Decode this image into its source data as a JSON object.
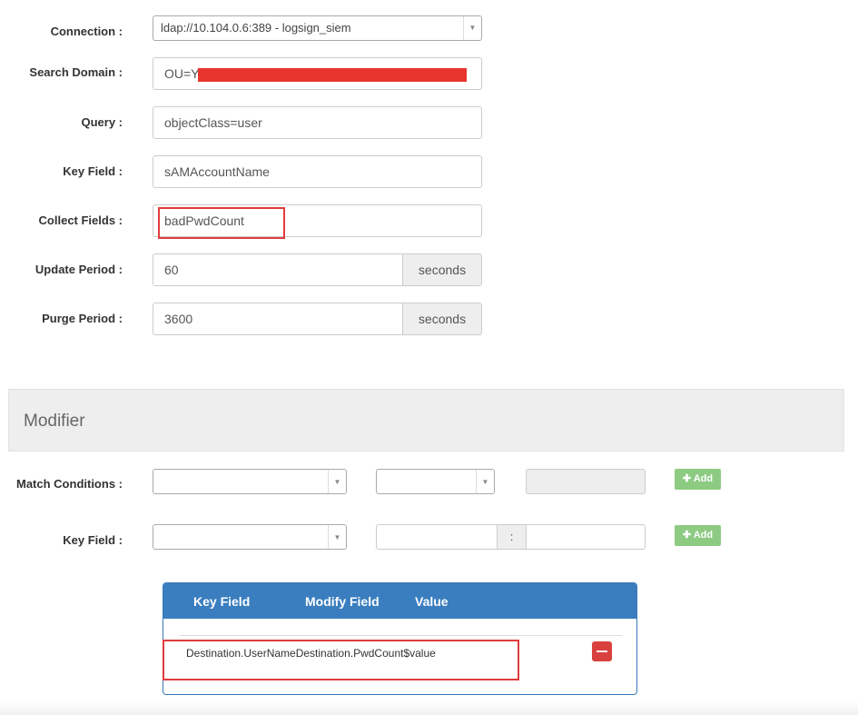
{
  "connection": {
    "label": "Connection :",
    "value": "ldap://10.104.0.6:389 - logsign_siem"
  },
  "search_domain": {
    "label": "Search Domain :",
    "value": "OU=Y"
  },
  "query": {
    "label": "Query :",
    "value": "objectClass=user"
  },
  "key_field": {
    "label": "Key Field :",
    "value": "sAMAccountName"
  },
  "collect_fields": {
    "label": "Collect Fields :",
    "value": "badPwdCount"
  },
  "update_period": {
    "label": "Update Period :",
    "value": "60",
    "unit": "seconds"
  },
  "purge_period": {
    "label": "Purge Period :",
    "value": "3600",
    "unit": "seconds"
  },
  "modifier": {
    "title": "Modifier",
    "match_conditions_label": "Match Conditions :",
    "key_field_label": "Key Field :",
    "separator": ":",
    "add_label": "Add"
  },
  "table": {
    "headers": [
      "Key Field",
      "Modify Field",
      "Value"
    ],
    "rows": [
      {
        "key_field": "Destination.UserName",
        "modify_field": "Destination.PwdCount",
        "value": "$value"
      }
    ]
  },
  "colors": {
    "accent": "#3a7ebf",
    "add_button": "#8dcb83",
    "remove_button": "#d9413e",
    "highlight": "#e03c3c"
  }
}
